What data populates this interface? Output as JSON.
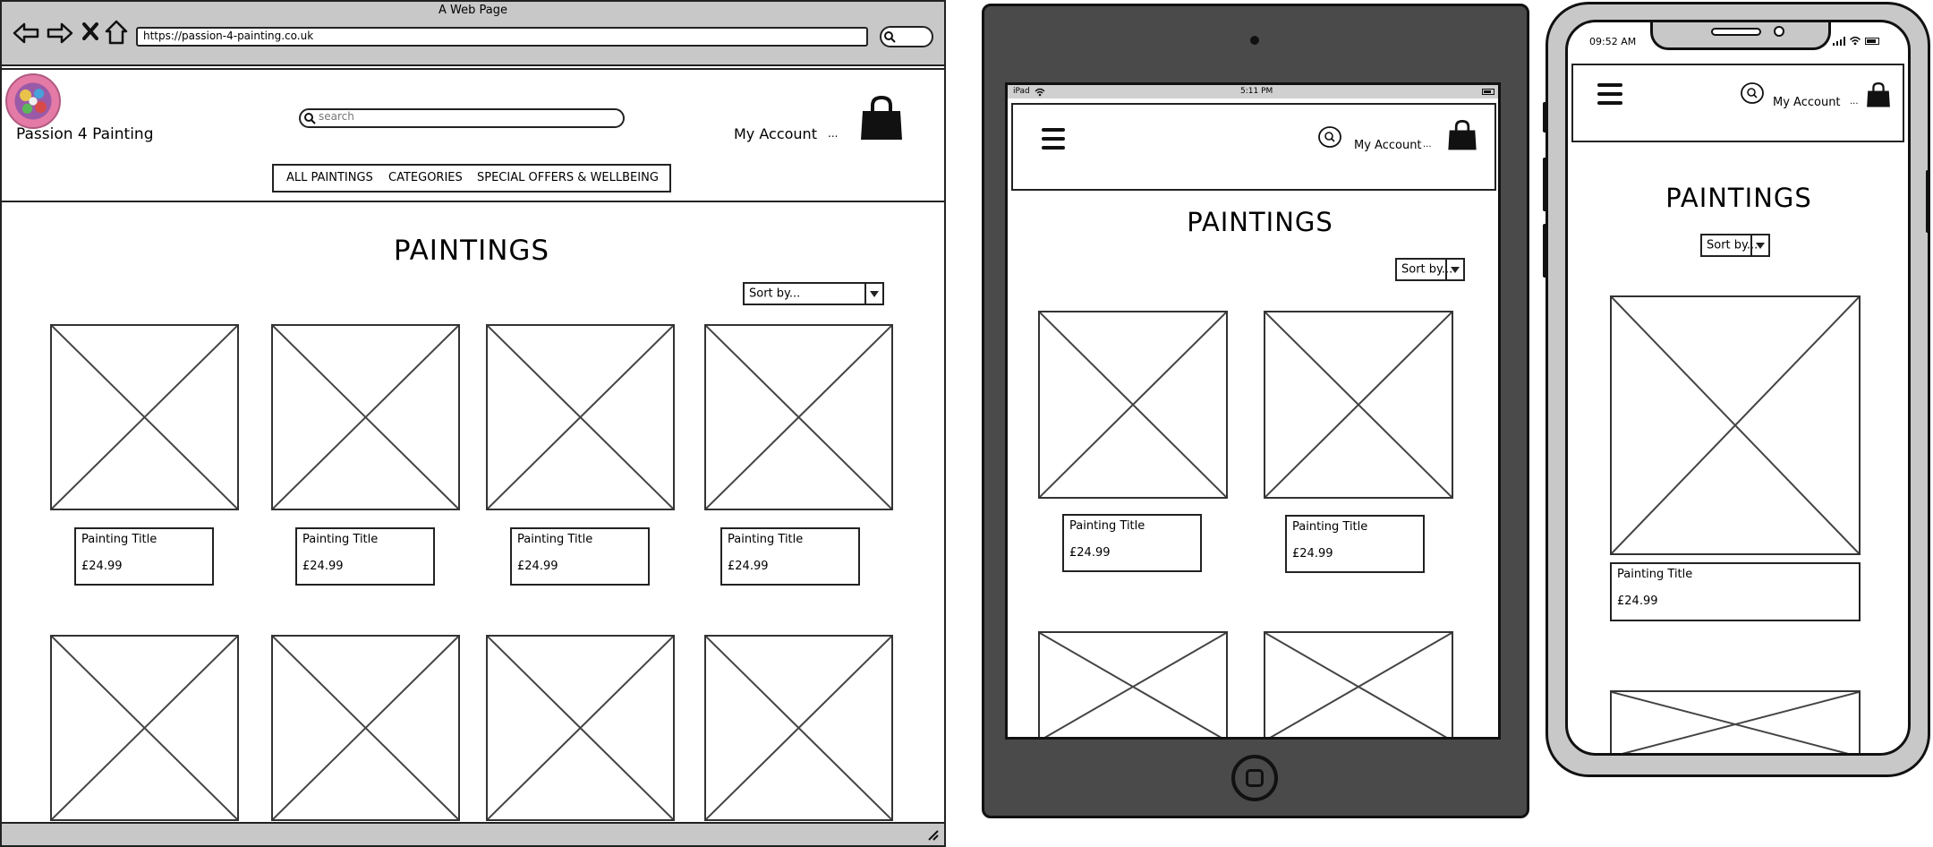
{
  "browser": {
    "window_title": "A Web Page",
    "url": "https://passion-4-painting.co.uk"
  },
  "desktop": {
    "brand_name": "Passion 4 Painting",
    "search_placeholder": "search",
    "account_label": "My Account",
    "more_label": "...",
    "nav": [
      "ALL PAINTINGS",
      "CATEGORIES",
      "SPECIAL OFFERS & WELLBEING"
    ],
    "page_title": "PAINTINGS",
    "sort_label": "Sort by...",
    "products": [
      {
        "title": "Painting Title",
        "price": "£24.99"
      },
      {
        "title": "Painting Title",
        "price": "£24.99"
      },
      {
        "title": "Painting Title",
        "price": "£24.99"
      },
      {
        "title": "Painting Title",
        "price": "£24.99"
      }
    ]
  },
  "tablet": {
    "status_left": "iPad",
    "status_time": "5:11 PM",
    "account_label": "My Account",
    "more_label": "...",
    "page_title": "PAINTINGS",
    "sort_label": "Sort by...",
    "products": [
      {
        "title": "Painting Title",
        "price": "£24.99"
      },
      {
        "title": "Painting Title",
        "price": "£24.99"
      }
    ]
  },
  "phone": {
    "status_time": "09:52 AM",
    "account_label": "My Account",
    "more_label": "...",
    "page_title": "PAINTINGS",
    "sort_label": "Sort by...",
    "products": [
      {
        "title": "Painting Title",
        "price": "£24.99"
      }
    ]
  },
  "colors": {
    "chrome_gray": "#c8c8c8",
    "tablet_frame": "#4a4a4a",
    "outline": "#222222",
    "logo_pink": "#e47aa6"
  }
}
